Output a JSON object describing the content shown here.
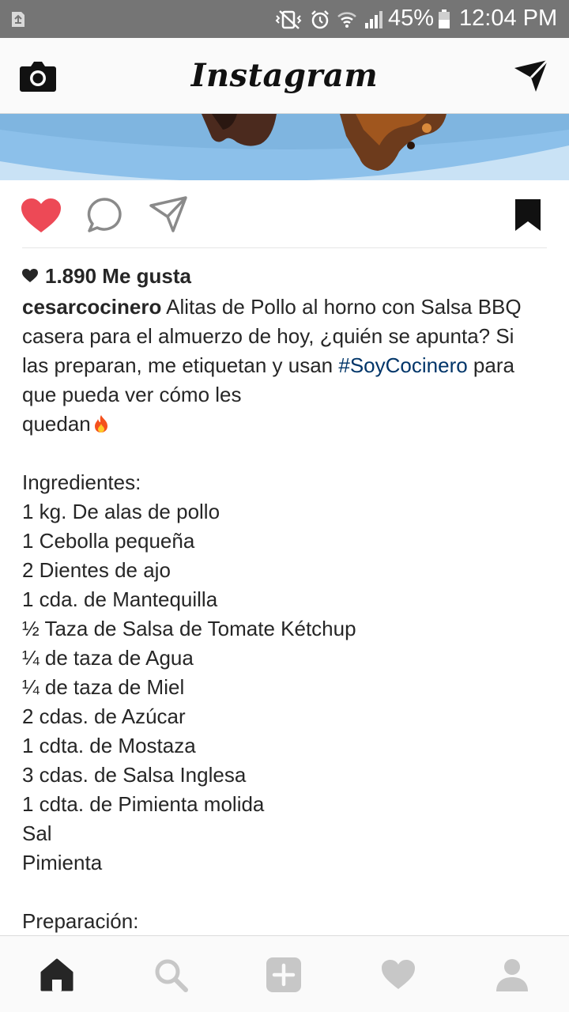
{
  "status_bar": {
    "battery_percent": "45%",
    "time": "12:04 PM",
    "icons": [
      "recycle-icon",
      "vibrate-icon",
      "alarm-icon",
      "wifi-icon",
      "signal-icon",
      "battery-icon"
    ]
  },
  "header": {
    "logo": "Instagram",
    "icons": [
      "camera-icon",
      "direct-message-icon"
    ]
  },
  "actions": {
    "liked": true,
    "icons": [
      "heart-icon",
      "comment-icon",
      "share-icon",
      "bookmark-icon"
    ],
    "like_color": "#ed4956"
  },
  "post": {
    "likes_text": "1.890 Me gusta",
    "username": "cesarcocinero",
    "caption_line1": "Alitas de Pollo al horno con Salsa BBQ",
    "caption_line2": "casera para el almuerzo de hoy, ¿quién se apunta? Si",
    "caption_line3_before": "las preparan, me etiquetan y usan",
    "hashtag": "#SoyCocinero",
    "caption_line3_after": "para",
    "caption_line4": "que pueda ver cómo les",
    "caption_line5": "quedan",
    "ingredients_heading": "Ingredientes:",
    "ingredients": [
      "1 kg. De alas de pollo",
      "1 Cebolla pequeña",
      "2 Dientes de ajo",
      "1 cda. de Mantequilla",
      "½ Taza de Salsa de Tomate Kétchup",
      "¼ de taza de Agua",
      "¼ de taza de Miel",
      "2 cdas. de Azúcar",
      "1 cdta. de Mostaza",
      "3 cdas. de Salsa Inglesa",
      "1 cdta. de Pimienta molida",
      "Sal",
      "Pimienta"
    ],
    "preparation_heading": "Preparación:"
  },
  "bottom_nav": {
    "items": [
      "home-icon",
      "search-icon",
      "add-post-icon",
      "activity-heart-icon",
      "profile-icon"
    ],
    "active": "home-icon"
  },
  "colors": {
    "hashtag": "#003569",
    "status_bar": "#757575",
    "nav_inactive": "#c7c7c7"
  }
}
